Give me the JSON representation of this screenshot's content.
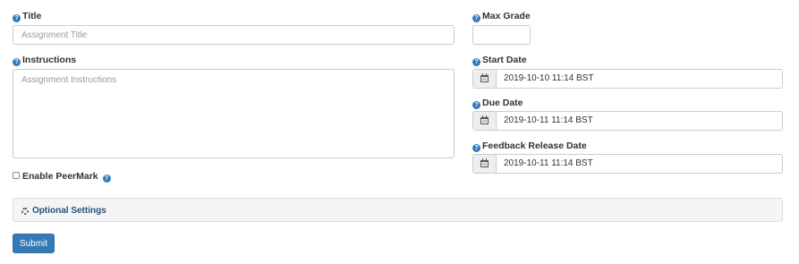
{
  "form": {
    "title": {
      "label": "Title",
      "placeholder": "Assignment Title",
      "value": ""
    },
    "instructions": {
      "label": "Instructions",
      "placeholder": "Assignment Instructions",
      "value": ""
    },
    "peermark": {
      "label": "Enable PeerMark",
      "checked": false
    },
    "max_grade": {
      "label": "Max Grade",
      "value": ""
    },
    "start_date": {
      "label": "Start Date",
      "value": "2019-10-10 11:14 BST"
    },
    "due_date": {
      "label": "Due Date",
      "value": "2019-10-11 11:14 BST"
    },
    "feedback_release_date": {
      "label": "Feedback Release Date",
      "value": "2019-10-11 11:14 BST"
    },
    "optional_settings": {
      "label": "Optional Settings",
      "icon": "gear-icon"
    },
    "submit_label": "Submit"
  },
  "icons": {
    "help": "question-circle-icon",
    "calendar": "calendar-icon"
  },
  "colors": {
    "primary": "#337ab7",
    "help_icon": "#337ab7",
    "panel_bg": "#f5f5f5"
  }
}
